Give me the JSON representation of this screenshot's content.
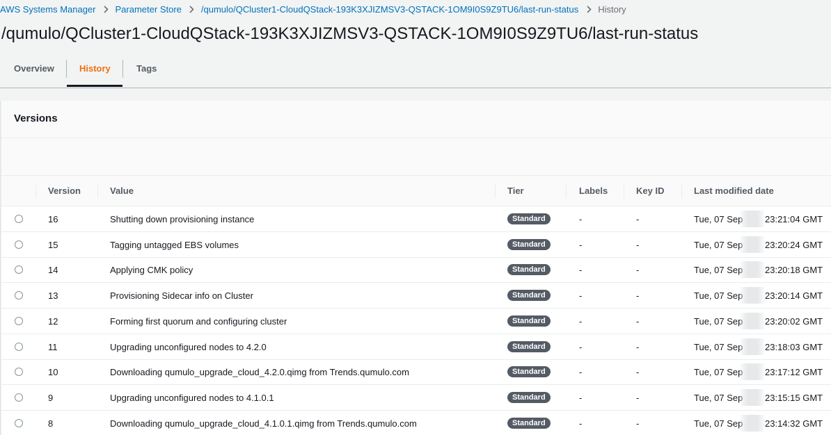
{
  "breadcrumb": {
    "items": [
      "AWS Systems Manager",
      "Parameter Store",
      "/qumulo/QCluster1-CloudQStack-193K3XJIZMSV3-QSTACK-1OM9I0S9Z9TU6/last-run-status"
    ],
    "current": "History"
  },
  "page_title": "/qumulo/QCluster1-CloudQStack-193K3XJIZMSV3-QSTACK-1OM9I0S9Z9TU6/last-run-status",
  "tabs": [
    {
      "label": "Overview"
    },
    {
      "label": "History",
      "active": true
    },
    {
      "label": "Tags"
    }
  ],
  "versions": {
    "title": "Versions",
    "columns": {
      "version": "Version",
      "value": "Value",
      "tier": "Tier",
      "labels": "Labels",
      "key_id": "Key ID",
      "last_modified": "Last modified date"
    },
    "rows": [
      {
        "version": "16",
        "value": "Shutting down provisioning instance",
        "tier": "Standard",
        "labels": "-",
        "key_id": "-",
        "date": "Tue, 07 Sep",
        "time": "23:21:04 GMT"
      },
      {
        "version": "15",
        "value": "Tagging untagged EBS volumes",
        "tier": "Standard",
        "labels": "-",
        "key_id": "-",
        "date": "Tue, 07 Sep",
        "time": "23:20:24 GMT"
      },
      {
        "version": "14",
        "value": "Applying CMK policy",
        "tier": "Standard",
        "labels": "-",
        "key_id": "-",
        "date": "Tue, 07 Sep",
        "time": "23:20:18 GMT"
      },
      {
        "version": "13",
        "value": "Provisioning Sidecar info on Cluster",
        "tier": "Standard",
        "labels": "-",
        "key_id": "-",
        "date": "Tue, 07 Sep",
        "time": "23:20:14 GMT"
      },
      {
        "version": "12",
        "value": "Forming first quorum and configuring cluster",
        "tier": "Standard",
        "labels": "-",
        "key_id": "-",
        "date": "Tue, 07 Sep",
        "time": "23:20:02 GMT"
      },
      {
        "version": "11",
        "value": "Upgrading unconfigured nodes to 4.2.0",
        "tier": "Standard",
        "labels": "-",
        "key_id": "-",
        "date": "Tue, 07 Sep",
        "time": "23:18:03 GMT"
      },
      {
        "version": "10",
        "value": "Downloading qumulo_upgrade_cloud_4.2.0.qimg from Trends.qumulo.com",
        "tier": "Standard",
        "labels": "-",
        "key_id": "-",
        "date": "Tue, 07 Sep",
        "time": "23:17:12 GMT"
      },
      {
        "version": "9",
        "value": "Upgrading unconfigured nodes to 4.1.0.1",
        "tier": "Standard",
        "labels": "-",
        "key_id": "-",
        "date": "Tue, 07 Sep",
        "time": "23:15:15 GMT"
      },
      {
        "version": "8",
        "value": "Downloading qumulo_upgrade_cloud_4.1.0.1.qimg from Trends.qumulo.com",
        "tier": "Standard",
        "labels": "-",
        "key_id": "-",
        "date": "Tue, 07 Sep",
        "time": "23:14:32 GMT"
      }
    ]
  },
  "colors": {
    "link": "#0073bb",
    "active_tab": "#ec7211",
    "badge": "#545b64"
  }
}
